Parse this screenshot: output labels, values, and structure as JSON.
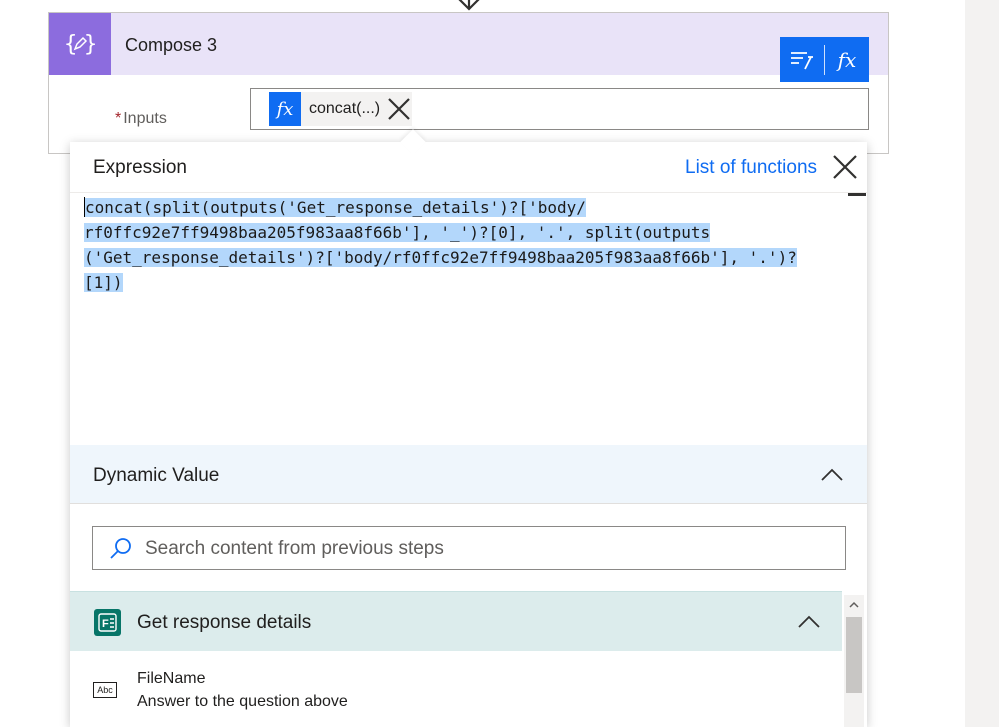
{
  "card": {
    "title": "Compose 3",
    "inputs_label": "Inputs",
    "required_mark": "*",
    "token_label": "concat(...)",
    "fx_symbol": "fx"
  },
  "popup": {
    "tab_expression": "Expression",
    "tab_list_functions": "List of functions",
    "expression_lines": [
      "oncat(split(outputs('Get_response_details')?['body/",
      "rf0ffc92e7ff9498baa205f983aa8f66b'], '_')?[0], '.', split(outputs",
      "('Get_response_details')?['body/rf0ffc92e7ff9498baa205f983aa8f66b'], '.')?",
      "[1])"
    ],
    "expression_first_char": "c",
    "dynamic": {
      "title": "Dynamic Value",
      "search_placeholder": "Search content from previous steps",
      "group_title": "Get response details",
      "items": [
        {
          "type_icon": "Abc",
          "name": "FileName",
          "description": "Answer to the question above"
        }
      ]
    }
  },
  "colors": {
    "accent": "#0f6cf2",
    "compose_icon": "#8c6cde",
    "compose_header": "#e9e3f8",
    "selection": "#b3d7fb",
    "dynamic_header": "#eff6fc",
    "group_header": "#dcecec",
    "forms_icon": "#077568"
  }
}
